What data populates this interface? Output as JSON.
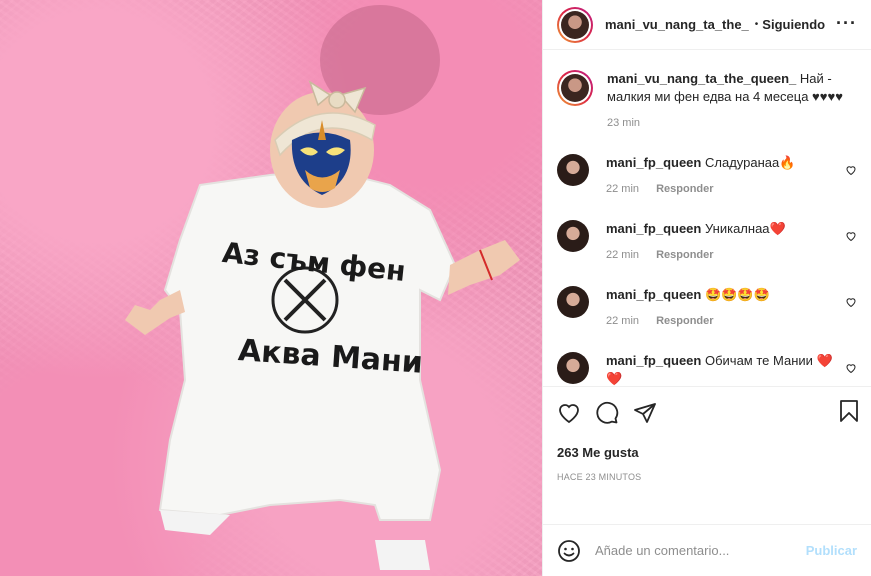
{
  "post": {
    "author": "mani_vu_nang_ta_the_",
    "author_full": "mani_vu_nang_ta_the_queen_",
    "follow_state": "Siguiendo",
    "separator": "•",
    "more_icon": "more-options-icon",
    "photo_text_top": "Аз съм фен",
    "photo_text_bottom": "Аква Мани"
  },
  "caption": {
    "text": "Най - малкия ми фен едва на 4 месеца ♥♥♥♥",
    "time": "23 min"
  },
  "comments": [
    {
      "user": "mani_fp_queen",
      "text": "Сладуранаа🔥",
      "time": "22 min",
      "reply": "Responder"
    },
    {
      "user": "mani_fp_queen",
      "text": "Уникалнаа❤️",
      "time": "22 min",
      "reply": "Responder"
    },
    {
      "user": "mani_fp_queen",
      "text": "🤩🤩🤩🤩",
      "time": "22 min",
      "reply": "Responder"
    },
    {
      "user": "mani_fp_queen",
      "text": "Обичам те Мании ❤️❤️",
      "time": "",
      "reply": ""
    }
  ],
  "actions": {
    "likes": "263 Me gusta",
    "posted": "HACE 23 MINUTOS"
  },
  "add_comment": {
    "placeholder": "Añade un comentario...",
    "publish": "Publicar"
  },
  "colors": {
    "photo_bg": "#f39abd",
    "publish_disabled": "#b2dffc",
    "muted": "#8e8e8e"
  }
}
